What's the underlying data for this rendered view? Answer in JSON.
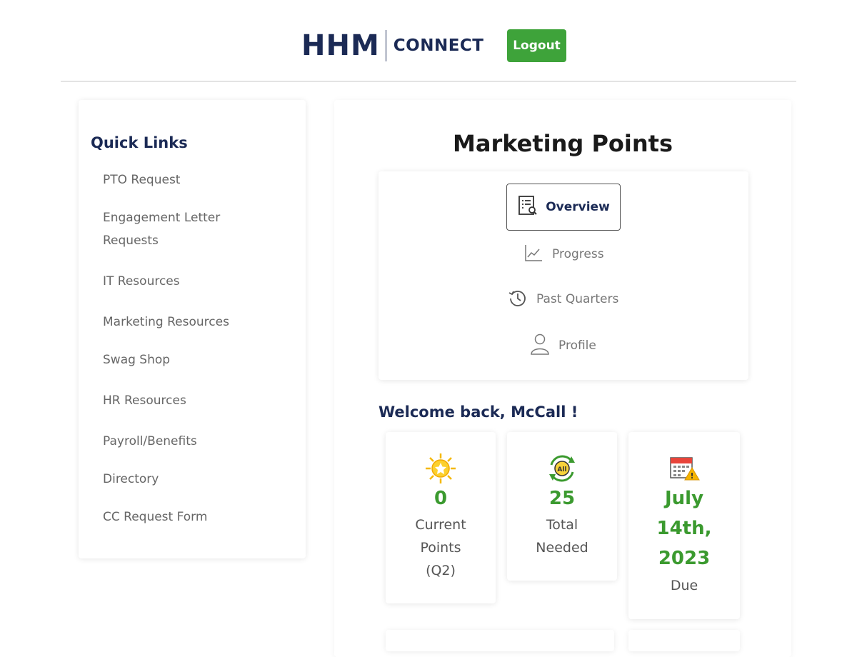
{
  "header": {
    "logo_hhm": "HHM",
    "logo_connect": "CONNECT",
    "logout_label": "Logout"
  },
  "quick_links": {
    "title": "Quick Links",
    "items": [
      "PTO Request",
      "Engagement Letter",
      "Requests",
      "IT Resources",
      "Marketing Resources",
      "Swag Shop",
      "HR Resources",
      "Payroll/Benefits",
      "Directory",
      "CC Request Form"
    ]
  },
  "main": {
    "title": "Marketing Points",
    "nav": {
      "overview": "Overview",
      "progress": "Progress",
      "past_quarters": "Past Quarters",
      "profile": "Profile"
    },
    "welcome": "Welcome back,  McCall !",
    "stats": {
      "current": {
        "value": "0",
        "label_line1": "Current",
        "label_line2": "Points",
        "label_line3": "(Q2)",
        "icon": "sun-star-icon"
      },
      "needed": {
        "value": "25",
        "label_line1": "Total",
        "label_line2": "Needed",
        "icon": "all-cycle-icon"
      },
      "due": {
        "line1": "July",
        "line2": "14th,",
        "line3": "2023",
        "label": "Due",
        "icon": "calendar-warning-icon"
      }
    }
  },
  "colors": {
    "brand_navy": "#1b2a55",
    "logout_green": "#3ea33a",
    "stat_green": "#3b9a2f"
  }
}
